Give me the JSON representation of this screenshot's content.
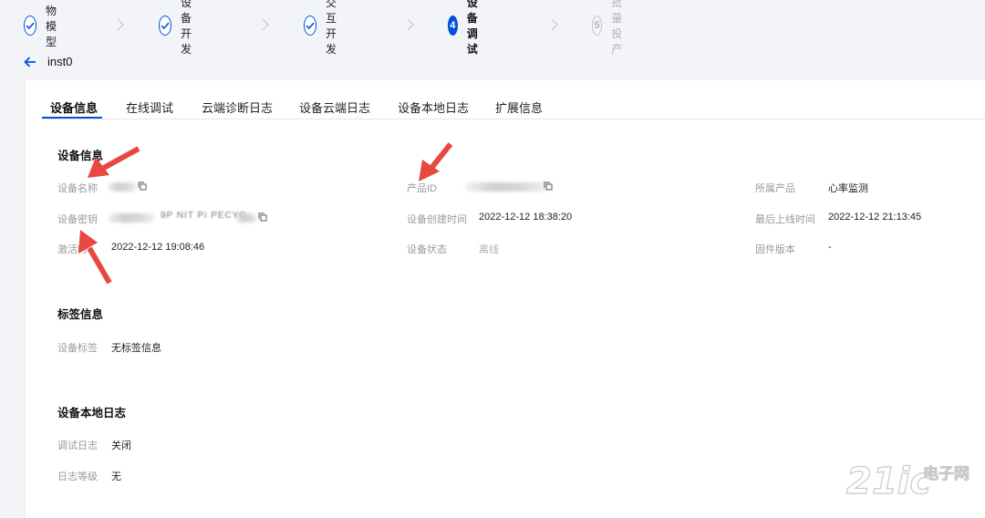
{
  "steps": [
    {
      "num": "1",
      "label": "物模型",
      "state": "done"
    },
    {
      "num": "2",
      "label": "设备开发",
      "state": "done"
    },
    {
      "num": "3",
      "label": "交互开发",
      "state": "done"
    },
    {
      "num": "4",
      "label": "设备调试",
      "state": "active"
    },
    {
      "num": "5",
      "label": "批量投产",
      "state": "todo"
    }
  ],
  "header": {
    "title": "inst0"
  },
  "tabs": [
    "设备信息",
    "在线调试",
    "云端诊断日志",
    "设备云端日志",
    "设备本地日志",
    "扩展信息"
  ],
  "device_info": {
    "title": "设备信息",
    "name_label": "设备名称",
    "key_label": "设备密钥",
    "key_partial": "9P NIT Pi PECYC",
    "activated_label": "激活时",
    "activated_value": "2022-12-12 19:08:46",
    "product_id_label": "产品ID",
    "created_label": "设备创建时间",
    "created_value": "2022-12-12 18:38:20",
    "status_label": "设备状态",
    "status_value": "离线",
    "product_label": "所属产品",
    "product_value": "心率监测",
    "last_online_label": "最后上线时间",
    "last_online_value": "2022-12-12 21:13:45",
    "firmware_label": "固件版本",
    "firmware_value": "-"
  },
  "tags": {
    "title": "标签信息",
    "label": "设备标签",
    "value": "无标签信息"
  },
  "local_log": {
    "title": "设备本地日志",
    "debug_label": "调试日志",
    "debug_value": "关闭",
    "level_label": "日志等级",
    "level_value": "无"
  },
  "watermark": {
    "text": "21ic",
    "sub": "电子网"
  },
  "colors": {
    "accent": "#0052d9",
    "arrow": "#e8483f",
    "muted_step": "#b5b5b5"
  }
}
